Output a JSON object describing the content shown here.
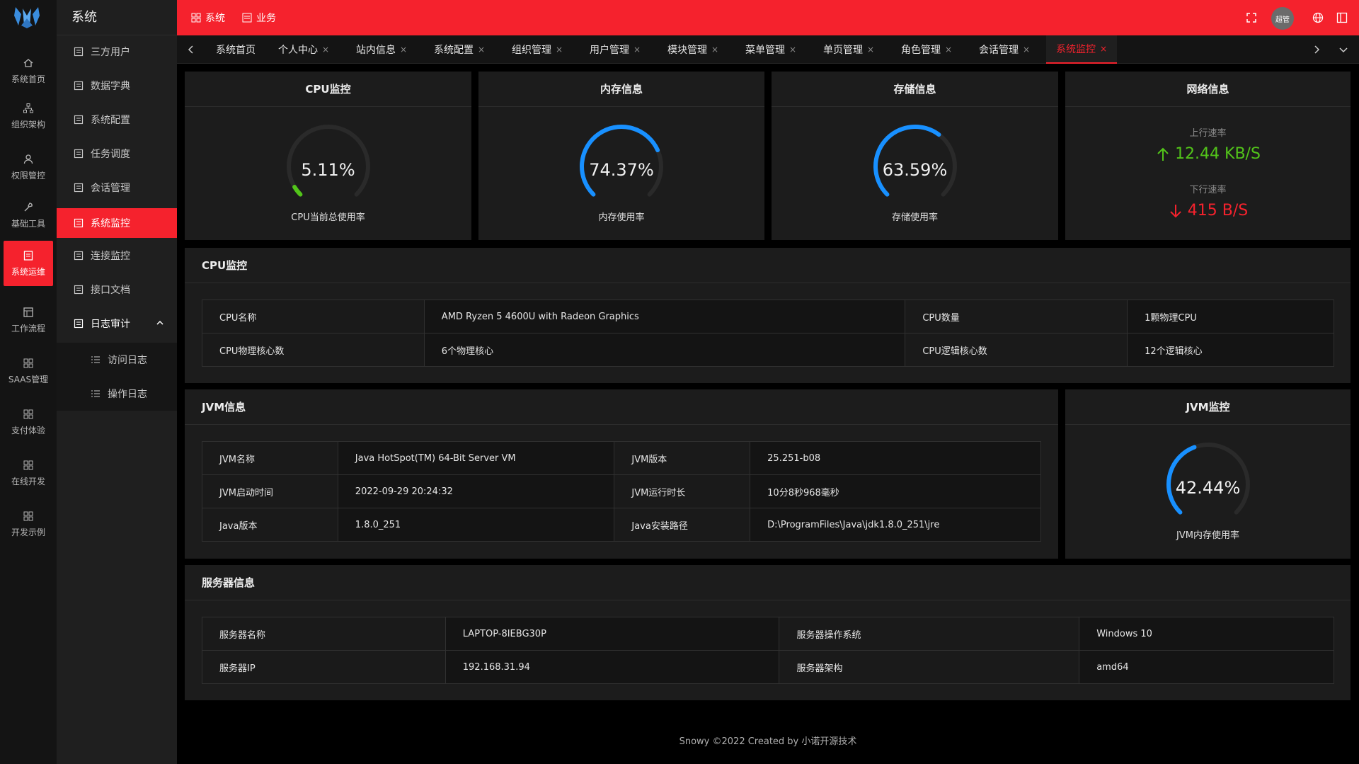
{
  "rail": {
    "items": [
      {
        "label": "系统首页",
        "icon": "home-icon"
      },
      {
        "label": "组织架构",
        "icon": "org-icon"
      },
      {
        "label": "权限管控",
        "icon": "user-icon"
      },
      {
        "label": "基础工具",
        "icon": "tool-icon"
      },
      {
        "label": "系统运维",
        "icon": "ops-icon"
      },
      {
        "label": "工作流程",
        "icon": "flow-icon"
      },
      {
        "label": "SAAS管理",
        "icon": "grid-icon"
      },
      {
        "label": "支付体验",
        "icon": "grid-icon"
      },
      {
        "label": "在线开发",
        "icon": "grid-icon"
      },
      {
        "label": "开发示例",
        "icon": "grid-icon"
      }
    ]
  },
  "sidebar": {
    "title": "系统",
    "items": [
      {
        "label": "三方用户"
      },
      {
        "label": "数据字典"
      },
      {
        "label": "系统配置"
      },
      {
        "label": "任务调度"
      },
      {
        "label": "会话管理"
      },
      {
        "label": "系统监控"
      },
      {
        "label": "连接监控"
      },
      {
        "label": "接口文档"
      },
      {
        "label": "日志审计"
      }
    ],
    "sub_items": [
      {
        "label": "访问日志"
      },
      {
        "label": "操作日志"
      }
    ]
  },
  "topbar": {
    "menu_system": "系统",
    "menu_business": "业务",
    "avatar_text": "超管",
    "accent": "#f5222d"
  },
  "tabs": [
    {
      "label": "系统首页",
      "closable": false
    },
    {
      "label": "个人中心",
      "closable": true
    },
    {
      "label": "站内信息",
      "closable": true
    },
    {
      "label": "系统配置",
      "closable": true
    },
    {
      "label": "组织管理",
      "closable": true
    },
    {
      "label": "用户管理",
      "closable": true
    },
    {
      "label": "模块管理",
      "closable": true
    },
    {
      "label": "菜单管理",
      "closable": true
    },
    {
      "label": "单页管理",
      "closable": true
    },
    {
      "label": "角色管理",
      "closable": true
    },
    {
      "label": "会话管理",
      "closable": true
    },
    {
      "label": "系统监控",
      "closable": true
    }
  ],
  "close_glyph": "×",
  "cpu_card": {
    "title": "CPU监控",
    "value_text": "5.11%",
    "value": 5.11,
    "label": "CPU当前总使用率",
    "color": "#52c41a"
  },
  "mem_card": {
    "title": "内存信息",
    "value_text": "74.37%",
    "value": 74.37,
    "label": "内存使用率",
    "color": "#1890ff"
  },
  "disk_card": {
    "title": "存储信息",
    "value_text": "63.59%",
    "value": 63.59,
    "label": "存储使用率",
    "color": "#1890ff"
  },
  "net_card": {
    "title": "网络信息",
    "up_label": "上行速率",
    "up_value": "12.44 KB/S",
    "up_color": "#52c41a",
    "down_label": "下行速率",
    "down_value": "415 B/S",
    "down_color": "#f5222d"
  },
  "cpu_info": {
    "title": "CPU监控",
    "rows": [
      [
        "CPU名称",
        "AMD Ryzen 5 4600U with Radeon Graphics",
        "CPU数量",
        "1颗物理CPU"
      ],
      [
        "CPU物理核心数",
        "6个物理核心",
        "CPU逻辑核心数",
        "12个逻辑核心"
      ]
    ]
  },
  "jvm_info": {
    "title": "JVM信息",
    "rows": [
      [
        "JVM名称",
        "Java HotSpot(TM) 64-Bit Server VM",
        "JVM版本",
        "25.251-b08"
      ],
      [
        "JVM启动时间",
        "2022-09-29 20:24:32",
        "JVM运行时长",
        "10分8秒968毫秒"
      ],
      [
        "Java版本",
        "1.8.0_251",
        "Java安装路径",
        "D:\\ProgramFiles\\Java\\jdk1.8.0_251\\jre"
      ]
    ]
  },
  "jvm_card": {
    "title": "JVM监控",
    "value_text": "42.44%",
    "value": 42.44,
    "label": "JVM内存使用率",
    "color": "#1890ff"
  },
  "server_info": {
    "title": "服务器信息",
    "rows": [
      [
        "服务器名称",
        "LAPTOP-8IEBG30P",
        "服务器操作系统",
        "Windows 10"
      ],
      [
        "服务器IP",
        "192.168.31.94",
        "服务器架构",
        "amd64"
      ]
    ]
  },
  "footer": {
    "text": "Snowy ©2022 Created by 小诺开源技术"
  }
}
